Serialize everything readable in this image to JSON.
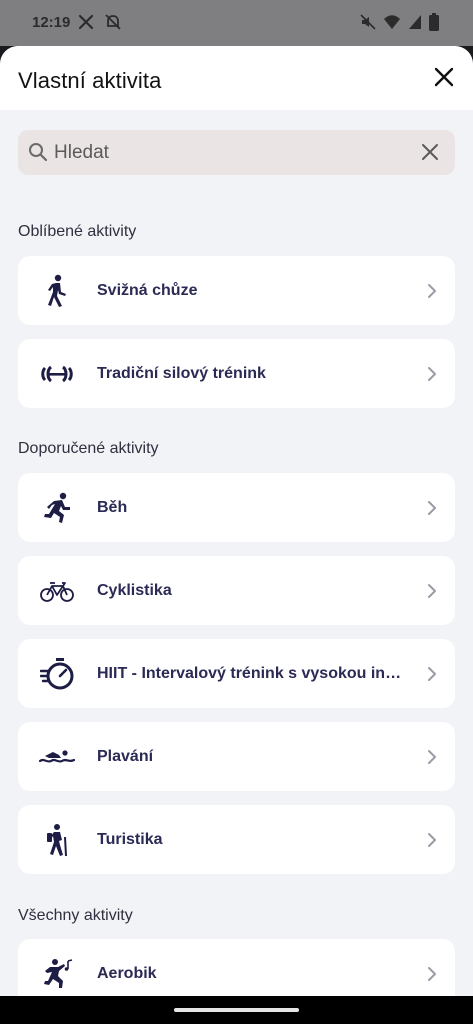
{
  "status_bar": {
    "time": "12:19",
    "left_icons": [
      "x-logo-icon",
      "notifications-off-icon"
    ],
    "right_icons": [
      "mute-icon",
      "wifi-icon",
      "signal-icon",
      "battery-icon"
    ]
  },
  "sheet": {
    "title": "Vlastní aktivita",
    "close_icon": "close-icon"
  },
  "search": {
    "placeholder": "Hledat",
    "value": ""
  },
  "sections": {
    "favorites": "Oblíbené aktivity",
    "recommended": "Doporučené aktivity",
    "all": "Všechny aktivity"
  },
  "favorite_items": [
    {
      "label": "Svižná chůze",
      "icon": "walking-icon"
    },
    {
      "label": "Tradiční silový trénink",
      "icon": "strength-training-icon"
    }
  ],
  "recommended_items": [
    {
      "label": "Běh",
      "icon": "running-icon"
    },
    {
      "label": "Cyklistika",
      "icon": "bicycle-icon"
    },
    {
      "label": "HIIT - Intervalový trénink s vysokou intenzitou",
      "icon": "hiit-stopwatch-icon"
    },
    {
      "label": "Plavání",
      "icon": "swimming-icon"
    },
    {
      "label": "Turistika",
      "icon": "hiking-icon"
    }
  ],
  "all_items": [
    {
      "label": "Aerobik",
      "icon": "aerobics-icon"
    }
  ],
  "colors": {
    "label": "#2a2a55",
    "icon": "#1d1d45",
    "background": "#f2f3f6",
    "search_bg": "#ebe4e4"
  }
}
